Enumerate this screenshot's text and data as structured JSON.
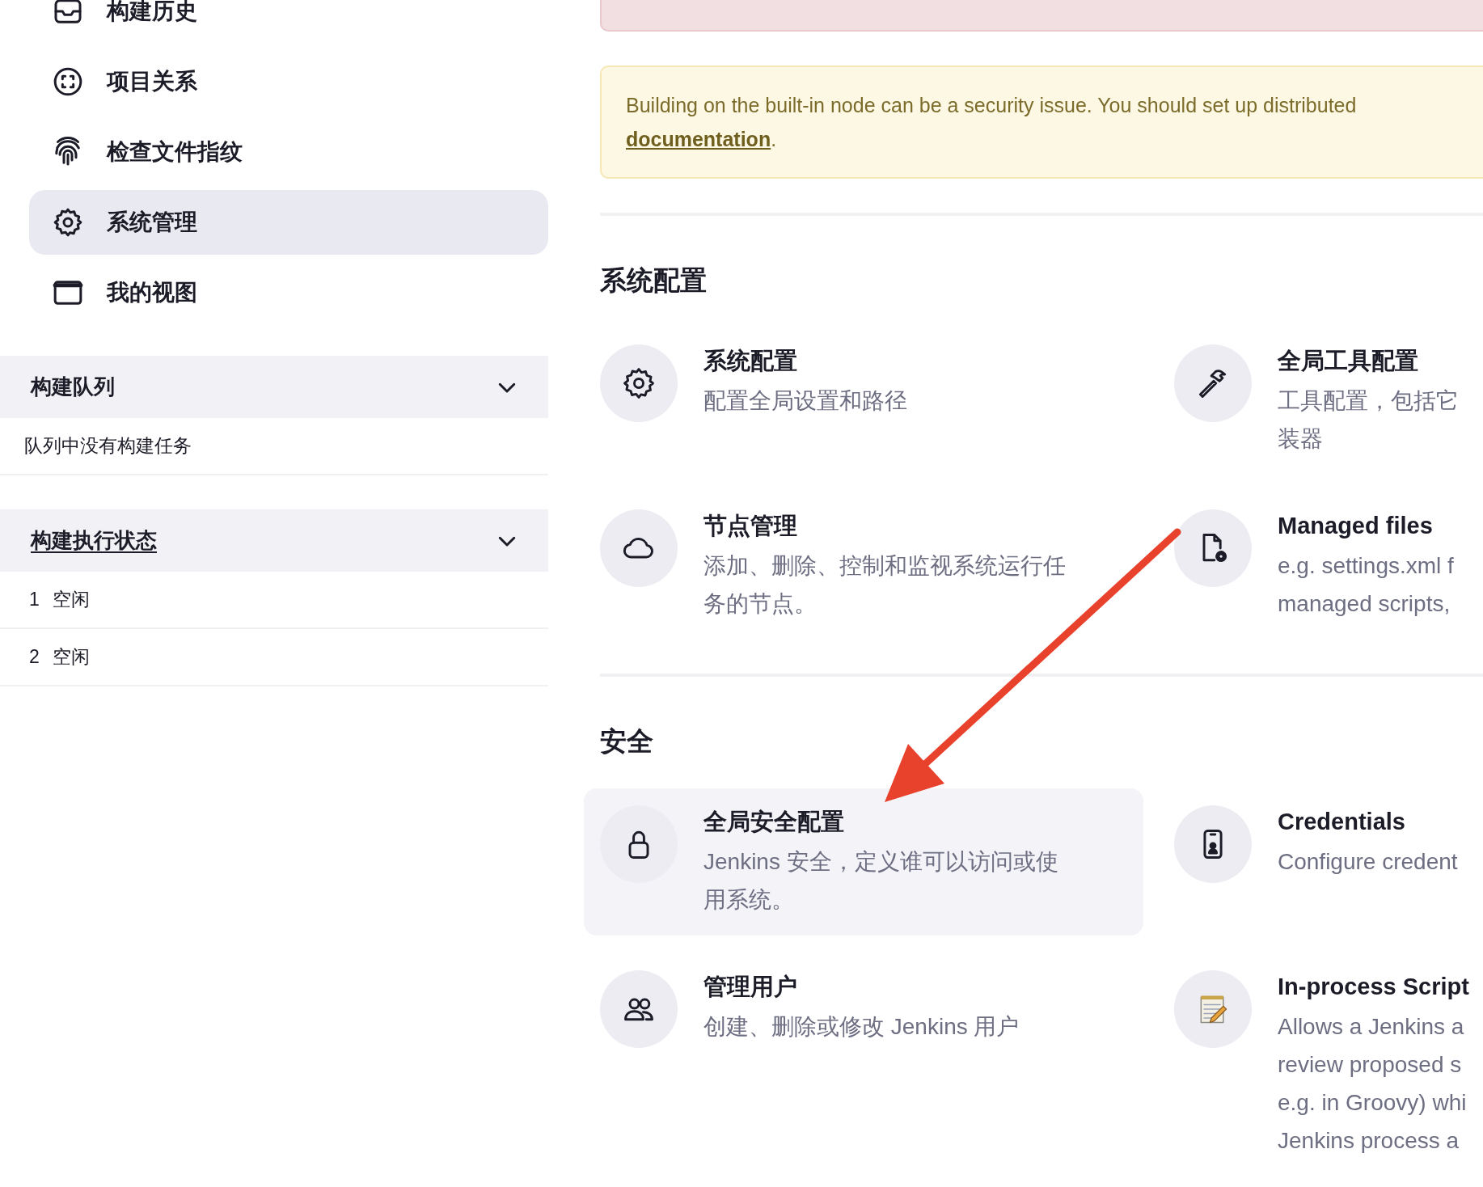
{
  "sidebar": {
    "items": [
      {
        "label": "构建历史",
        "selected": false
      },
      {
        "label": "项目关系",
        "selected": false
      },
      {
        "label": "检查文件指纹",
        "selected": false
      },
      {
        "label": "系统管理",
        "selected": true
      },
      {
        "label": "我的视图",
        "selected": false
      }
    ]
  },
  "panels": [
    {
      "title": "构建队列",
      "link": false,
      "rows": [
        {
          "text": "队列中没有构建任务"
        }
      ]
    },
    {
      "title": "构建执行状态",
      "link": true,
      "rows": [
        {
          "number": "1",
          "text": "空闲"
        },
        {
          "number": "2",
          "text": "空闲"
        }
      ]
    }
  ],
  "alerts": [
    {
      "kind": "error"
    },
    {
      "kind": "warning",
      "text": "Building on the built-in node can be a security issue. You should set up distributed",
      "link": "documentation",
      "text_after": "."
    }
  ],
  "sections": [
    {
      "title": "系统配置",
      "cards": [
        {
          "title": "系统配置",
          "description": "配置全局设置和路径",
          "highlighted": false
        },
        {
          "title": "全局工具配置",
          "description": "工具配置，包括它装器",
          "highlighted": false
        },
        {
          "title": "节点管理",
          "description": "添加、删除、控制和监视系统运行任务的节点。",
          "highlighted": false
        },
        {
          "title": "Managed files",
          "description": "e.g. settings.xml f\nmanaged scripts,",
          "highlighted": false
        }
      ]
    },
    {
      "title": "安全",
      "cards": [
        {
          "title": "全局安全配置",
          "description": "Jenkins 安全，定义谁可以访问或使用系统。",
          "highlighted": true
        },
        {
          "title": "Credentials",
          "description": "Configure credent",
          "highlighted": false
        },
        {
          "title": "管理用户",
          "description": "创建、删除或修改 Jenkins 用户",
          "highlighted": false
        },
        {
          "title": "In-process Script",
          "description": "Allows a Jenkins a\nreview proposed s\ne.g. in Groovy) whi\nJenkins process a",
          "highlighted": false
        }
      ]
    }
  ]
}
